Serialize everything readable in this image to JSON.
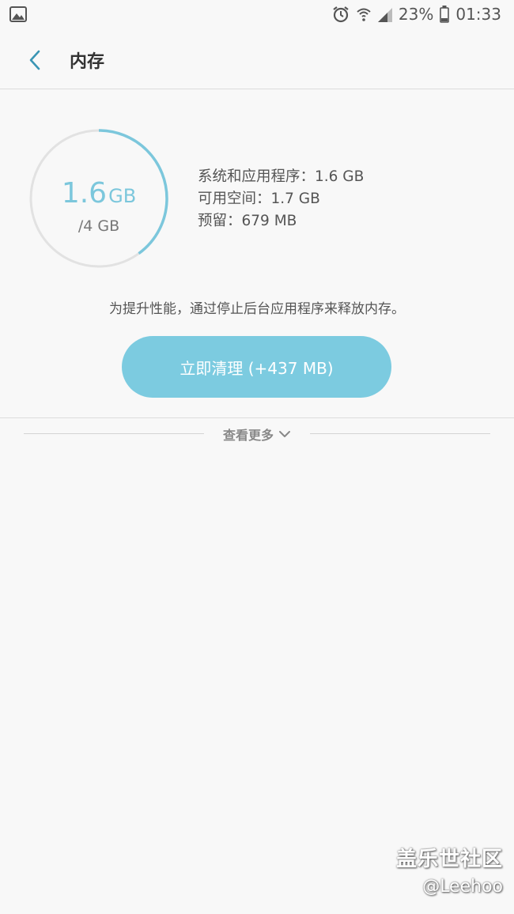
{
  "status_bar": {
    "battery": "23%",
    "time": "01:33",
    "icons": [
      "gallery-notification-icon",
      "alarm-icon",
      "wifi-icon",
      "signal-icon",
      "battery-icon"
    ]
  },
  "header": {
    "title": "内存"
  },
  "memory": {
    "used_value": "1.6",
    "used_unit": "GB",
    "total_text": "/4 GB",
    "usage_fraction": 0.4,
    "details": [
      "系统和应用程序：1.6 GB",
      "可用空间：1.7 GB",
      "预留：679 MB"
    ]
  },
  "hint": "为提升性能，通过停止后台应用程序来释放内存。",
  "clean_button": {
    "label": "立即清理 (+437 MB)"
  },
  "see_more": {
    "label": "查看更多"
  },
  "watermark": {
    "title": "盖乐世社区",
    "handle": "@Leehoo"
  },
  "colors": {
    "accent": "#7cc7dc",
    "button": "#7ccbe0",
    "background": "#f8f8f8"
  }
}
